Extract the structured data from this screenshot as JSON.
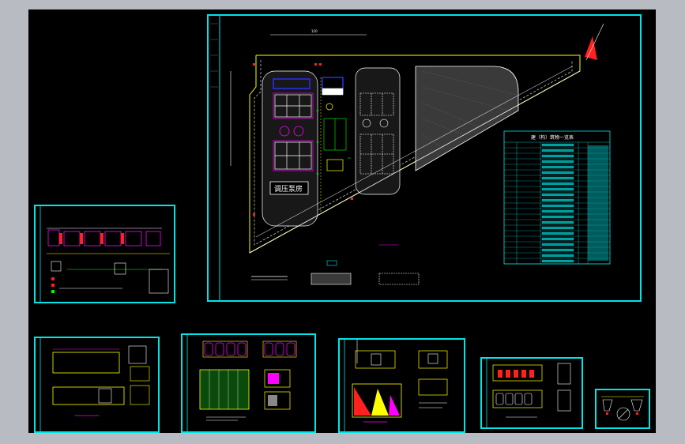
{
  "viewport": {
    "name": "cad-model-space"
  },
  "main_sheet": {
    "legend_table_title": "建（构）筑物一览表",
    "block_label": "调压泵房",
    "colors": {
      "frame": "#00e5e5",
      "line": "#ffff00",
      "accent": "#ff00ff",
      "hatch": "#888888",
      "red": "#ff2020",
      "blue": "#3030ff",
      "green": "#00ff00"
    }
  },
  "icons": {
    "north_arrow": "north-arrow-icon"
  }
}
